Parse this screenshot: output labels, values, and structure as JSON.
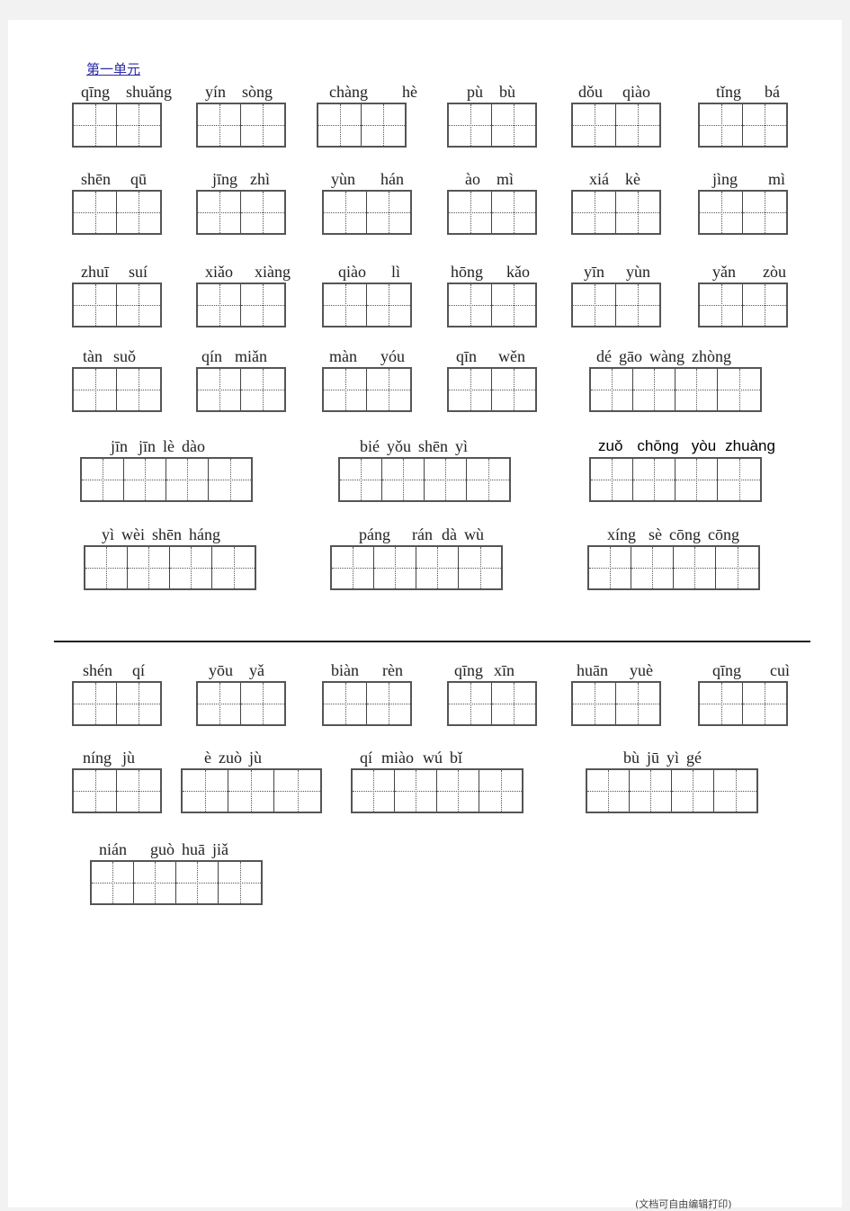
{
  "section_title": "第一单元",
  "footer_text": "(文档可自由编辑打印)",
  "words": [
    {
      "id": "w1",
      "pinyin": [
        "qīng",
        "shuǎng"
      ],
      "cells": 2
    },
    {
      "id": "w2",
      "pinyin": [
        "yín",
        "sòng"
      ],
      "cells": 2
    },
    {
      "id": "w3",
      "pinyin": [
        "chàng",
        "hè"
      ],
      "cells": 2
    },
    {
      "id": "w4",
      "pinyin": [
        "pù",
        "bù"
      ],
      "cells": 2
    },
    {
      "id": "w5",
      "pinyin": [
        "dǒu",
        "qiào"
      ],
      "cells": 2
    },
    {
      "id": "w6",
      "pinyin": [
        "tǐng",
        "bá"
      ],
      "cells": 2
    },
    {
      "id": "w7",
      "pinyin": [
        "shēn",
        "qū"
      ],
      "cells": 2
    },
    {
      "id": "w8",
      "pinyin": [
        "jīng",
        "zhì"
      ],
      "cells": 2
    },
    {
      "id": "w9",
      "pinyin": [
        "yùn",
        "hán"
      ],
      "cells": 2
    },
    {
      "id": "w10",
      "pinyin": [
        "ào",
        "mì"
      ],
      "cells": 2
    },
    {
      "id": "w11",
      "pinyin": [
        "xiá",
        "kè"
      ],
      "cells": 2
    },
    {
      "id": "w12",
      "pinyin": [
        "jìng",
        "mì"
      ],
      "cells": 2
    },
    {
      "id": "w13",
      "pinyin": [
        "zhuī",
        "suí"
      ],
      "cells": 2
    },
    {
      "id": "w14",
      "pinyin": [
        "xiǎo",
        "xiàng"
      ],
      "cells": 2
    },
    {
      "id": "w15",
      "pinyin": [
        "qiào",
        "lì"
      ],
      "cells": 2
    },
    {
      "id": "w16",
      "pinyin": [
        "hōng",
        "kǎo"
      ],
      "cells": 2
    },
    {
      "id": "w17",
      "pinyin": [
        "yīn",
        "yùn"
      ],
      "cells": 2
    },
    {
      "id": "w18",
      "pinyin": [
        "yǎn",
        "zòu"
      ],
      "cells": 2
    },
    {
      "id": "w19",
      "pinyin": [
        "tàn",
        "suǒ"
      ],
      "cells": 2
    },
    {
      "id": "w20",
      "pinyin": [
        "qín",
        "miǎn"
      ],
      "cells": 2
    },
    {
      "id": "w21",
      "pinyin": [
        "màn",
        "yóu"
      ],
      "cells": 2
    },
    {
      "id": "w22",
      "pinyin": [
        "qīn",
        "wěn"
      ],
      "cells": 2
    },
    {
      "id": "w23",
      "pinyin": [
        "dé",
        "gāo",
        "wàng",
        "zhòng"
      ],
      "cells": 4
    },
    {
      "id": "w24",
      "pinyin": [
        "jīn",
        "jīn",
        "lè",
        "dào"
      ],
      "cells": 4
    },
    {
      "id": "w25",
      "pinyin": [
        "bié",
        "yǒu",
        "shēn",
        "yì"
      ],
      "cells": 4
    },
    {
      "id": "w26",
      "pinyin": [
        "zuǒ",
        "chōng",
        "yòu",
        "zhuàng"
      ],
      "cells": 4
    },
    {
      "id": "w27",
      "pinyin": [
        "yì",
        "wèi",
        "shēn",
        "háng"
      ],
      "cells": 4
    },
    {
      "id": "w28",
      "pinyin": [
        "páng",
        "rán",
        "dà",
        "wù"
      ],
      "cells": 4
    },
    {
      "id": "w29",
      "pinyin": [
        "xíng",
        "sè",
        "cōng",
        "cōng"
      ],
      "cells": 4
    },
    {
      "id": "w30",
      "pinyin": [
        "shén",
        "qí"
      ],
      "cells": 2
    },
    {
      "id": "w31",
      "pinyin": [
        "yōu",
        "yǎ"
      ],
      "cells": 2
    },
    {
      "id": "w32",
      "pinyin": [
        "biàn",
        "rèn"
      ],
      "cells": 2
    },
    {
      "id": "w33",
      "pinyin": [
        "qīng",
        "xīn"
      ],
      "cells": 2
    },
    {
      "id": "w34",
      "pinyin": [
        "huān",
        "yuè"
      ],
      "cells": 2
    },
    {
      "id": "w35",
      "pinyin": [
        "qīng",
        "cuì"
      ],
      "cells": 2
    },
    {
      "id": "w36",
      "pinyin": [
        "níng",
        "jù"
      ],
      "cells": 2
    },
    {
      "id": "w37",
      "pinyin": [
        "è",
        "zuò",
        "jù"
      ],
      "cells": 3
    },
    {
      "id": "w38",
      "pinyin": [
        "qí",
        "miào",
        "wú",
        "bǐ"
      ],
      "cells": 4
    },
    {
      "id": "w39",
      "pinyin": [
        "bù",
        "jū",
        "yì",
        "gé"
      ],
      "cells": 4
    },
    {
      "id": "w40",
      "pinyin": [
        "nián",
        "guò",
        "huā",
        "jiǎ"
      ],
      "cells": 4
    }
  ]
}
